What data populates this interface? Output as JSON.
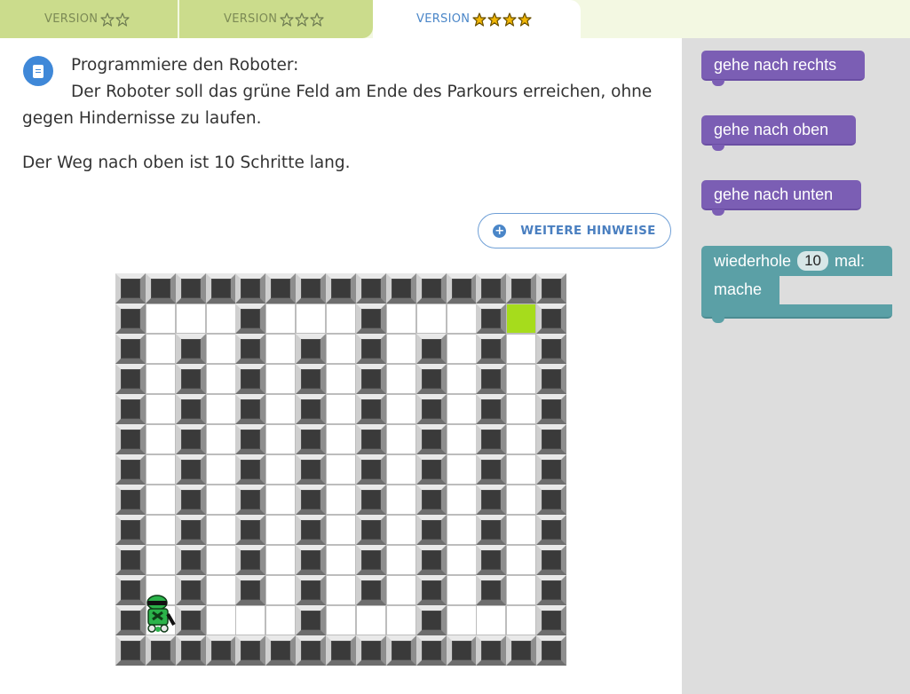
{
  "tabs": [
    {
      "label": "VERSION",
      "stars": 2,
      "active": false
    },
    {
      "label": "VERSION",
      "stars": 3,
      "active": false
    },
    {
      "label": "VERSION",
      "stars": 4,
      "active": true
    }
  ],
  "instructions": {
    "line1": "Programmiere den Roboter:",
    "line2": "Der Roboter soll das grüne Feld am Ende des Parkours erreichen, ohne",
    "line3": "gegen Hindernisse zu laufen.",
    "line4": "Der Weg nach oben ist 10 Schritte lang."
  },
  "hint_button": {
    "label": "WEITERE HINWEISE"
  },
  "maze": {
    "rows": [
      "###############",
      "#...#...#...#G#",
      "#.#.#.#.#.#.#.#",
      "#.#.#.#.#.#.#.#",
      "#.#.#.#.#.#.#.#",
      "#.#.#.#.#.#.#.#",
      "#.#.#.#.#.#.#.#",
      "#.#.#.#.#.#.#.#",
      "#.#.#.#.#.#.#.#",
      "#.#.#.#.#.#.#.#",
      "#.#.#.#.#.#.#.#",
      "#R#...#...#...#",
      "###############"
    ],
    "colors": {
      "goal": "#a6dc1c",
      "robot": "#2bb34a"
    }
  },
  "blocks": {
    "right": "gehe nach rechts",
    "up": "gehe nach oben",
    "down": "gehe nach unten",
    "loop_repeat": "wiederhole",
    "loop_count": "10",
    "loop_times": "mal:",
    "loop_do": "mache"
  },
  "colors": {
    "motion_block": "#7b5eb4",
    "control_block": "#5ba0a6",
    "accent": "#3f88d8"
  }
}
